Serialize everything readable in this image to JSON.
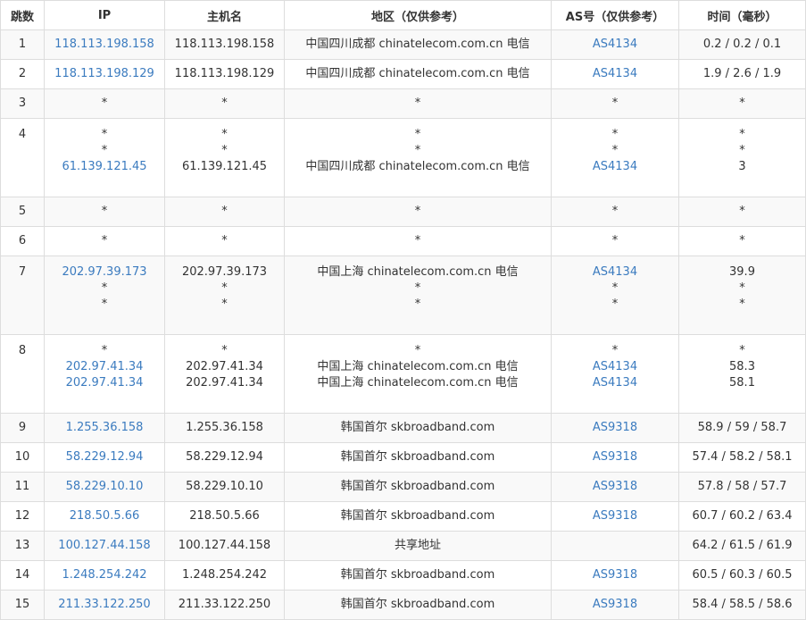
{
  "headers": [
    "跳数",
    "IP",
    "主机名",
    "地区（仅供参考）",
    "AS号（仅供参考）",
    "时间（毫秒）"
  ],
  "rows": [
    {
      "hop": "1",
      "lines": [
        [
          "118.113.198.158",
          "118.113.198.158",
          "中国四川成都 chinatelecom.com.cn 电信",
          "AS4134",
          "0.2 / 0.2 / 0.1"
        ]
      ]
    },
    {
      "hop": "2",
      "lines": [
        [
          "118.113.198.129",
          "118.113.198.129",
          "中国四川成都 chinatelecom.com.cn 电信",
          "AS4134",
          "1.9 / 2.6 / 1.9"
        ]
      ]
    },
    {
      "hop": "3",
      "lines": [
        [
          "*",
          "*",
          "*",
          "*",
          "*"
        ]
      ]
    },
    {
      "hop": "4",
      "lines": [
        [
          "*",
          "*",
          "*",
          "*",
          "*"
        ],
        [
          "*",
          "*",
          "*",
          "*",
          "*"
        ],
        [
          "61.139.121.45",
          "61.139.121.45",
          "中国四川成都 chinatelecom.com.cn 电信",
          "AS4134",
          "3"
        ]
      ]
    },
    {
      "hop": "5",
      "lines": [
        [
          "*",
          "*",
          "*",
          "*",
          "*"
        ]
      ]
    },
    {
      "hop": "6",
      "lines": [
        [
          "*",
          "*",
          "*",
          "*",
          "*"
        ]
      ]
    },
    {
      "hop": "7",
      "lines": [
        [
          "202.97.39.173",
          "202.97.39.173",
          "中国上海 chinatelecom.com.cn 电信",
          "AS4134",
          "39.9"
        ],
        [
          "*",
          "*",
          "*",
          "*",
          "*"
        ],
        [
          "*",
          "*",
          "*",
          "*",
          "*"
        ]
      ]
    },
    {
      "hop": "8",
      "lines": [
        [
          "*",
          "*",
          "*",
          "*",
          "*"
        ],
        [
          "202.97.41.34",
          "202.97.41.34",
          "中国上海 chinatelecom.com.cn 电信",
          "AS4134",
          "58.3"
        ],
        [
          "202.97.41.34",
          "202.97.41.34",
          "中国上海 chinatelecom.com.cn 电信",
          "AS4134",
          "58.1"
        ]
      ]
    },
    {
      "hop": "9",
      "lines": [
        [
          "1.255.36.158",
          "1.255.36.158",
          "韩国首尔 skbroadband.com",
          "AS9318",
          "58.9 / 59 / 58.7"
        ]
      ]
    },
    {
      "hop": "10",
      "lines": [
        [
          "58.229.12.94",
          "58.229.12.94",
          "韩国首尔 skbroadband.com",
          "AS9318",
          "57.4 / 58.2 / 58.1"
        ]
      ]
    },
    {
      "hop": "11",
      "lines": [
        [
          "58.229.10.10",
          "58.229.10.10",
          "韩国首尔 skbroadband.com",
          "AS9318",
          "57.8 / 58 / 57.7"
        ]
      ]
    },
    {
      "hop": "12",
      "lines": [
        [
          "218.50.5.66",
          "218.50.5.66",
          "韩国首尔 skbroadband.com",
          "AS9318",
          "60.7 / 60.2 / 63.4"
        ]
      ]
    },
    {
      "hop": "13",
      "lines": [
        [
          "100.127.44.158",
          "100.127.44.158",
          "共享地址",
          "",
          "64.2 / 61.5 / 61.9"
        ]
      ]
    },
    {
      "hop": "14",
      "lines": [
        [
          "1.248.254.242",
          "1.248.254.242",
          "韩国首尔 skbroadband.com",
          "AS9318",
          "60.5 / 60.3 / 60.5"
        ]
      ]
    },
    {
      "hop": "15",
      "lines": [
        [
          "211.33.122.250",
          "211.33.122.250",
          "韩国首尔 skbroadband.com",
          "AS9318",
          "58.4 / 58.5 / 58.6"
        ]
      ]
    }
  ]
}
